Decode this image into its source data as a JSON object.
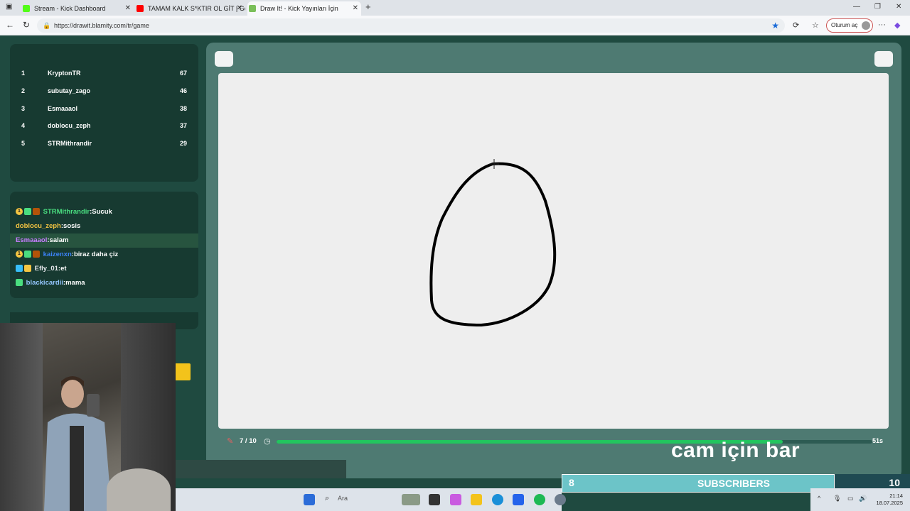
{
  "browser": {
    "tabs": [
      {
        "title": "Stream - Kick Dashboard",
        "favicon_color": "#53fc18"
      },
      {
        "title": "TAMAM KALK S*KTIR OL GİT | Ge",
        "favicon_color": "#ff0000"
      },
      {
        "title": "Draw It! - Kick Yayınları İçin",
        "favicon_color": "#7bbf5a"
      }
    ],
    "url": "https://drawit.blamity.com/tr/game",
    "login_label": "Oturum aç"
  },
  "leaderboard": [
    {
      "rank": "1",
      "name": "KryptonTR",
      "score": "67"
    },
    {
      "rank": "2",
      "name": "subutay_zago",
      "score": "46"
    },
    {
      "rank": "3",
      "name": "Esmaaaol",
      "score": "38"
    },
    {
      "rank": "4",
      "name": "doblocu_zeph",
      "score": "37"
    },
    {
      "rank": "5",
      "name": "STRMithrandir",
      "score": "29"
    }
  ],
  "chat": [
    {
      "user": "STRMithrandir",
      "message": "Sucuk",
      "user_color": "#4ade80"
    },
    {
      "user": "doblocu_zeph",
      "message": "sosis",
      "user_color": "#f5c542"
    },
    {
      "user": "Esmaaaol",
      "message": "salam",
      "user_color": "#c77dff"
    },
    {
      "user": "kaizenxn",
      "message": "biraz daha çiz",
      "user_color": "#3b82f6"
    },
    {
      "user": "Efly_01",
      "message": "et",
      "user_color": "#e5e7eb"
    },
    {
      "user": "blackicardii",
      "message": "mama",
      "user_color": "#93c5fd"
    }
  ],
  "game": {
    "round_label": "7 / 10",
    "time_label": "51s",
    "progress": 0.85
  },
  "overlay": {
    "cam_text": "cam için bar",
    "subs_current": "8",
    "subs_label": "SUBSCRIBERS",
    "subs_goal": "10"
  },
  "taskbar": {
    "search_label": "Ara",
    "time": "21:14",
    "date": "18.07.2025"
  }
}
